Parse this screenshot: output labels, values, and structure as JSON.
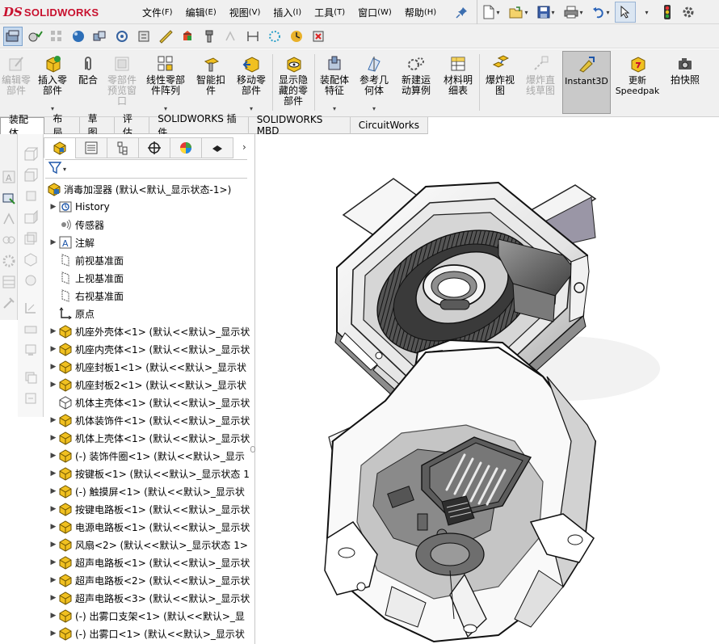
{
  "app": {
    "logo_ds": "DS",
    "logo_text": "SOLIDWORKS"
  },
  "menu": [
    {
      "label": "文件",
      "hotkey": "(F)"
    },
    {
      "label": "编辑",
      "hotkey": "(E)"
    },
    {
      "label": "视图",
      "hotkey": "(V)"
    },
    {
      "label": "插入",
      "hotkey": "(I)"
    },
    {
      "label": "工具",
      "hotkey": "(T)"
    },
    {
      "label": "窗口",
      "hotkey": "(W)"
    },
    {
      "label": "帮助",
      "hotkey": "(H)"
    }
  ],
  "quick_access": [
    "new-icon",
    "open-icon",
    "save-icon",
    "print-icon",
    "undo-icon",
    "select-icon",
    "rebuild-icon"
  ],
  "command_manager": [
    {
      "label": "编辑零\n部件",
      "enabled": false
    },
    {
      "label": "插入零\n部件",
      "enabled": true
    },
    {
      "label": "配合",
      "enabled": true
    },
    {
      "label": "零部件\n预览窗\n口",
      "enabled": false
    },
    {
      "label": "线性零部\n件阵列",
      "enabled": true
    },
    {
      "label": "智能扣\n件",
      "enabled": true
    },
    {
      "label": "移动零\n部件",
      "enabled": true
    },
    {
      "label": "显示隐\n藏的零\n部件",
      "enabled": true
    },
    {
      "label": "装配体\n特征",
      "enabled": true
    },
    {
      "label": "参考几\n何体",
      "enabled": true
    },
    {
      "label": "新建运\n动算例",
      "enabled": true
    },
    {
      "label": "材料明\n细表",
      "enabled": true
    },
    {
      "label": "爆炸视\n图",
      "enabled": true
    },
    {
      "label": "爆炸直\n线草图",
      "enabled": false
    },
    {
      "label": "Instant3D",
      "enabled": true
    },
    {
      "label": "更新\nSpeedpak",
      "enabled": true
    },
    {
      "label": "拍快照",
      "enabled": true
    }
  ],
  "tabs": [
    "装配体",
    "布局",
    "草图",
    "评估",
    "SOLIDWORKS 插件",
    "SOLIDWORKS MBD",
    "CircuitWorks"
  ],
  "feature_tree": {
    "root": "消毒加湿器 (默认<默认_显示状态-1>)",
    "items": [
      {
        "label": "History",
        "type": "history",
        "expand": true
      },
      {
        "label": "传感器",
        "type": "sensor",
        "expand": false
      },
      {
        "label": "注解",
        "type": "annotation",
        "expand": true
      },
      {
        "label": "前视基准面",
        "type": "plane",
        "expand": false
      },
      {
        "label": "上视基准面",
        "type": "plane",
        "expand": false
      },
      {
        "label": "右视基准面",
        "type": "plane",
        "expand": false
      },
      {
        "label": "原点",
        "type": "origin",
        "expand": false
      },
      {
        "label": "机座外壳体<1> (默认<<默认>_显示状",
        "type": "part",
        "expand": true
      },
      {
        "label": "机座内壳体<1> (默认<<默认>_显示状",
        "type": "part",
        "expand": true
      },
      {
        "label": "机座封板1<1> (默认<<默认>_显示状",
        "type": "part",
        "expand": true
      },
      {
        "label": "机座封板2<1> (默认<<默认>_显示状",
        "type": "part",
        "expand": true
      },
      {
        "label": "机体主壳体<1> (默认<<默认>_显示状",
        "type": "part-outline",
        "expand": false
      },
      {
        "label": "机体装饰件<1> (默认<<默认>_显示状",
        "type": "part",
        "expand": true
      },
      {
        "label": "机体上壳体<1> (默认<<默认>_显示状",
        "type": "part",
        "expand": true
      },
      {
        "label": "(-) 装饰件圈<1> (默认<<默认>_显示",
        "type": "part",
        "expand": true
      },
      {
        "label": "按键板<1> (默认<<默认>_显示状态 1",
        "type": "part",
        "expand": true
      },
      {
        "label": "(-) 触摸屏<1> (默认<<默认>_显示状",
        "type": "part",
        "expand": true
      },
      {
        "label": "按键电路板<1> (默认<<默认>_显示状",
        "type": "part",
        "expand": true
      },
      {
        "label": "电源电路板<1> (默认<<默认>_显示状",
        "type": "part",
        "expand": true
      },
      {
        "label": "风扇<2> (默认<<默认>_显示状态 1>",
        "type": "part",
        "expand": true
      },
      {
        "label": "超声电路板<1> (默认<<默认>_显示状",
        "type": "part",
        "expand": true
      },
      {
        "label": "超声电路板<2> (默认<<默认>_显示状",
        "type": "part",
        "expand": true
      },
      {
        "label": "超声电路板<3> (默认<<默认>_显示状",
        "type": "part",
        "expand": true
      },
      {
        "label": "(-) 出雾口支架<1> (默认<<默认>_显",
        "type": "part",
        "expand": true
      },
      {
        "label": "(-) 出雾口<1> (默认<<默认>_显示状",
        "type": "part",
        "expand": true
      }
    ]
  },
  "colors": {
    "accent_red": "#c8102e",
    "part_yellow": "#f0c020",
    "selection_blue": "#c6d9ee"
  }
}
